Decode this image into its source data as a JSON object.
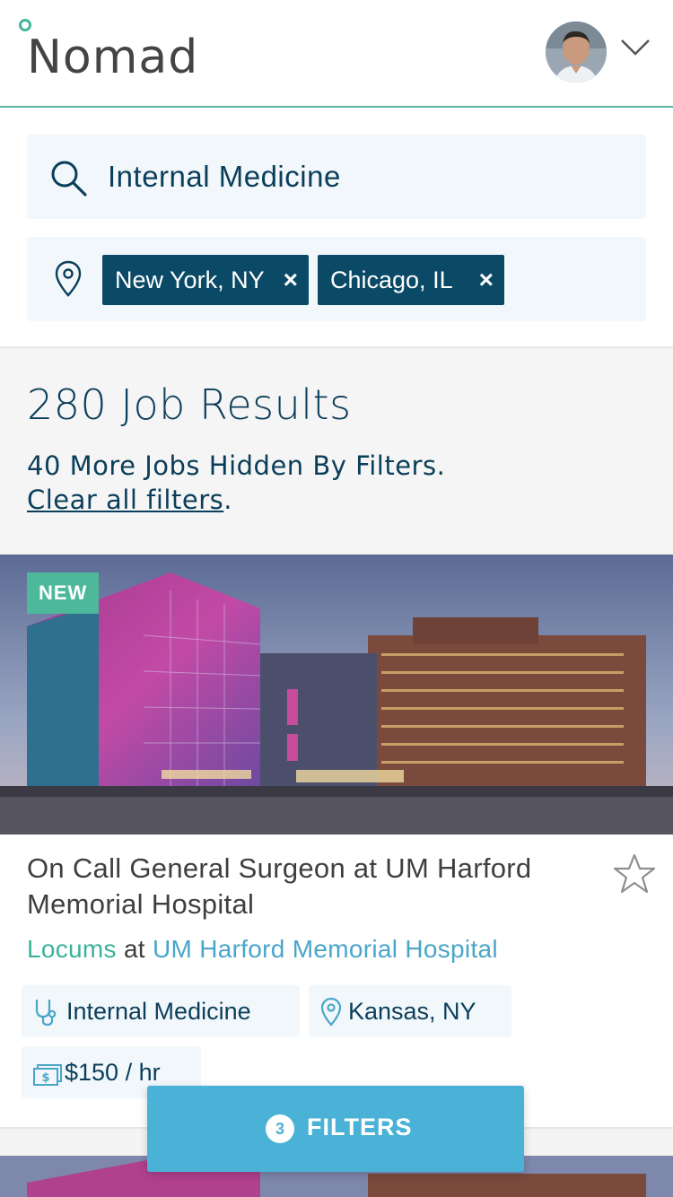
{
  "app": {
    "name": "Nomad"
  },
  "colors": {
    "brand_teal": "#45b59c",
    "navy": "#0b3e5a",
    "chip_bg": "#0b4a66",
    "accent_blue": "#4ab2d6",
    "badge_green": "#4db99a"
  },
  "header": {
    "logo_text": "Nomad",
    "avatar_icon": "user-avatar",
    "menu_icon": "chevron-down-icon"
  },
  "search": {
    "value": "Internal Medicine",
    "icon": "search-icon"
  },
  "locations": {
    "icon": "map-pin-icon",
    "chips": [
      {
        "label": "New York, NY",
        "remove": "×"
      },
      {
        "label": "Chicago, IL",
        "remove": "×"
      }
    ]
  },
  "results": {
    "count_text": "280 Job Results",
    "hidden_text": "40 More Jobs Hidden By Filters.",
    "clear_link": "Clear all filters",
    "clear_suffix": "."
  },
  "job": {
    "badge": "NEW",
    "title": "On Call General Surgeon at UM Harford Memorial Hospital",
    "type": "Locums",
    "at": "at",
    "hospital": "UM Harford Memorial Hospital",
    "specialty": "Internal Medicine",
    "location": "Kansas, NY",
    "pay": "$150 / hr",
    "favorite_icon": "star-outline-icon"
  },
  "filters_button": {
    "count": "3",
    "label": "FILTERS"
  }
}
